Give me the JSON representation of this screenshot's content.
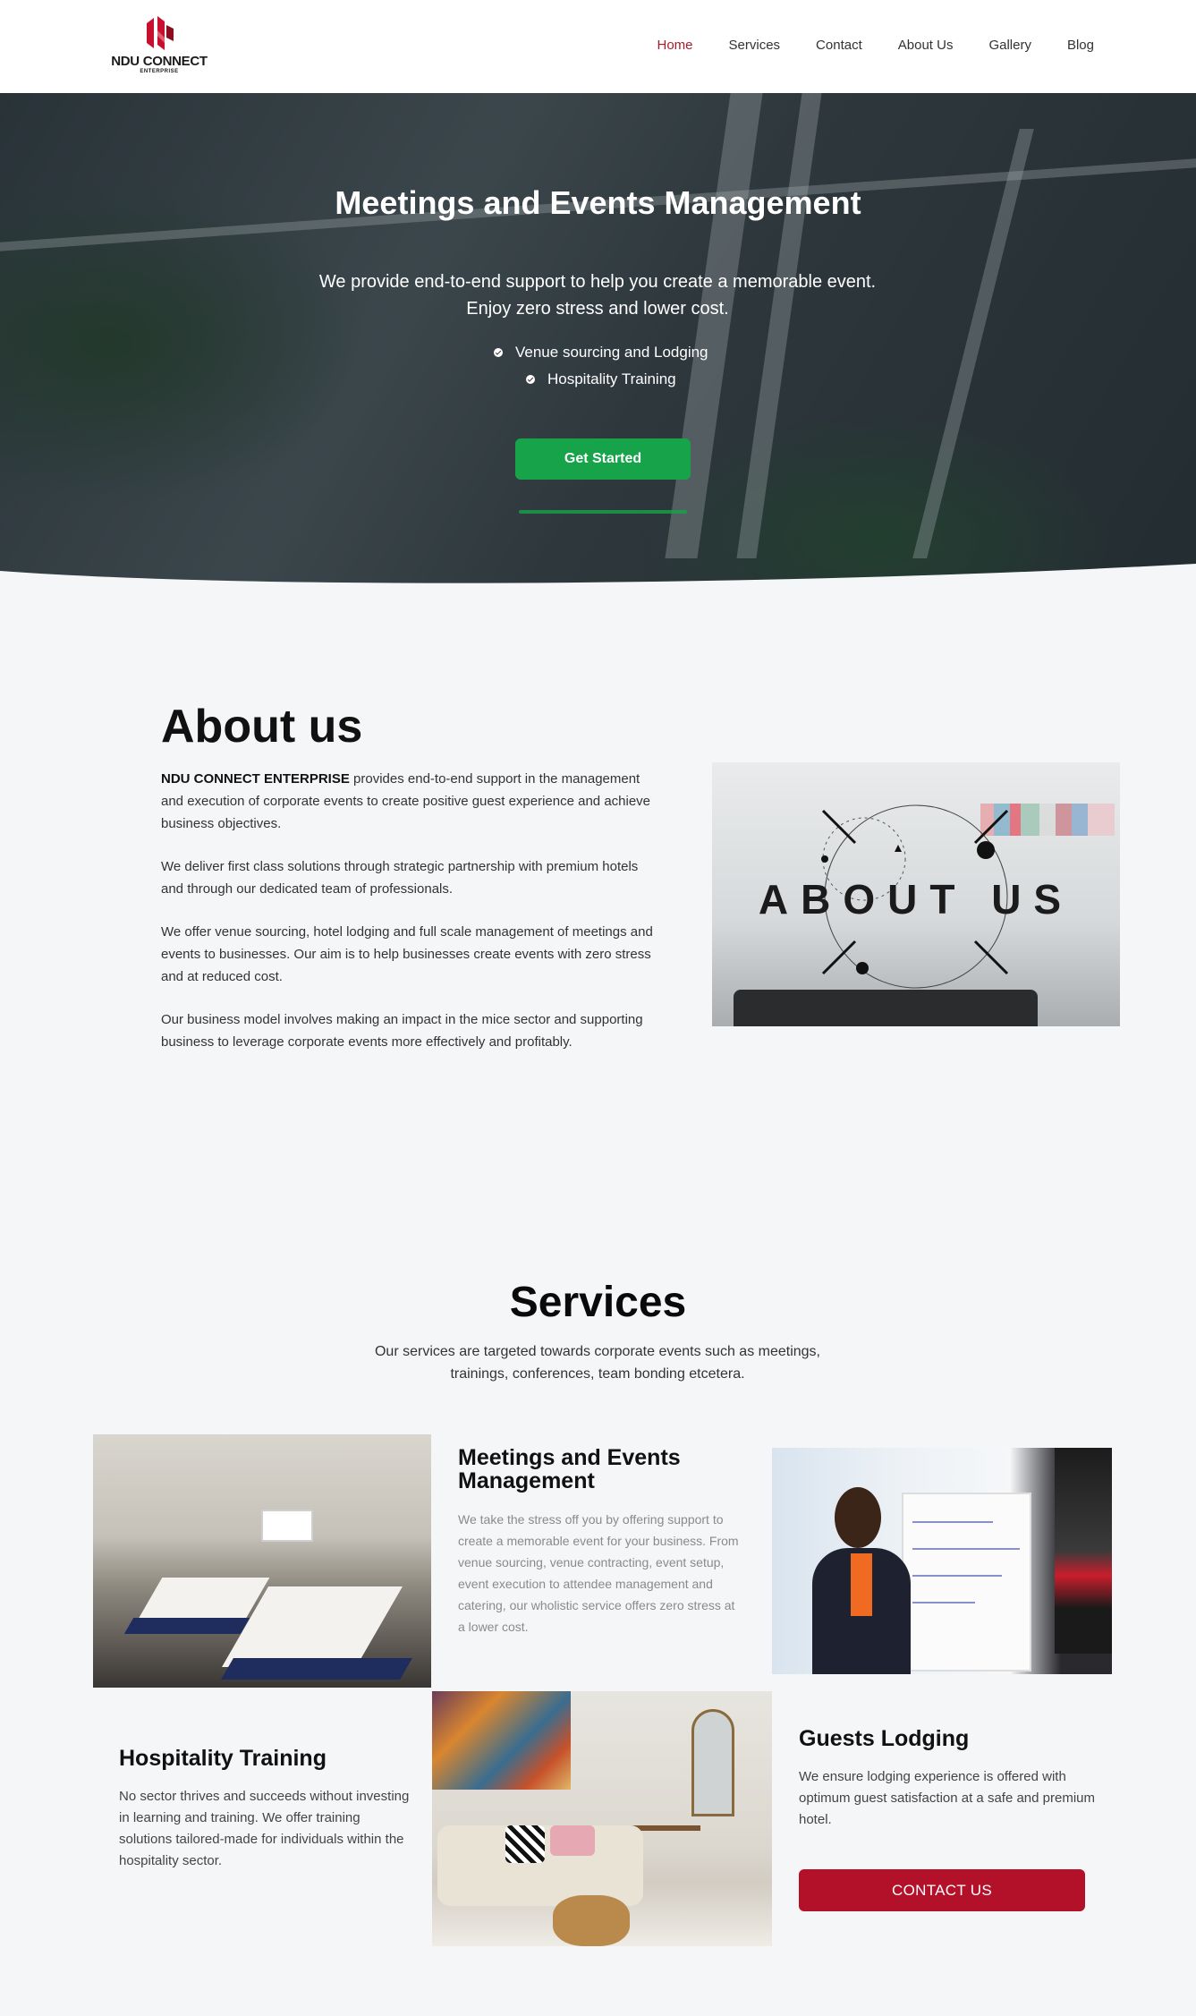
{
  "brand": {
    "name": "NDU CONNECT",
    "sub": "ENTERPRISE",
    "accent": "#a51d2b"
  },
  "nav": {
    "items": [
      {
        "label": "Home"
      },
      {
        "label": "Services"
      },
      {
        "label": "Contact"
      },
      {
        "label": "About Us"
      },
      {
        "label": "Gallery"
      },
      {
        "label": "Blog"
      }
    ],
    "active": "Home"
  },
  "hero": {
    "title": "Meetings and Events Management",
    "subtitle_line1": "We provide end-to-end support to help you create a memorable event.",
    "subtitle_line2": "Enjoy zero stress and lower cost.",
    "bullets": [
      "Venue sourcing and Lodging",
      "Hospitality Training"
    ],
    "cta_label": "Get Started",
    "cta_color": "#16a34a"
  },
  "about": {
    "title": "About us",
    "lead_bold": "NDU CONNECT ENTERPRISE",
    "p1_rest": " provides end-to-end support in the management and execution of corporate events to create positive guest experience and achieve business objectives.",
    "p2": "We deliver first class solutions through strategic partnership with premium hotels and through our dedicated team of professionals.",
    "p3": "We offer venue sourcing, hotel lodging and full scale management of meetings and events to businesses. Our aim is to help businesses create events with zero stress and at reduced cost.",
    "p4": "Our business model involves making an impact in the mice sector and supporting business to leverage corporate events more effectively and profitably.",
    "image_text": "ABOUT US"
  },
  "services": {
    "title": "Services",
    "subtitle": "Our services are targeted towards corporate events such as meetings, trainings, conferences, team bonding etcetera.",
    "meetings": {
      "title": "Meetings and Events Management",
      "text": "We take the stress off you by offering support to create a memorable event  for your business. From venue sourcing, venue contracting, event setup, event execution to attendee management and catering, our wholistic service offers zero stress at a lower cost."
    },
    "hospitality": {
      "title": "Hospitality Training",
      "text": "No sector thrives and succeeds without investing in learning and training. We offer training solutions tailored-made for individuals within the hospitality sector."
    },
    "lodging": {
      "title": "Guests Lodging",
      "text": "We ensure lodging experience is offered with optimum guest satisfaction at a safe and premium hotel."
    },
    "contact_label": "CONTACT US",
    "contact_color": "#b3102a"
  }
}
